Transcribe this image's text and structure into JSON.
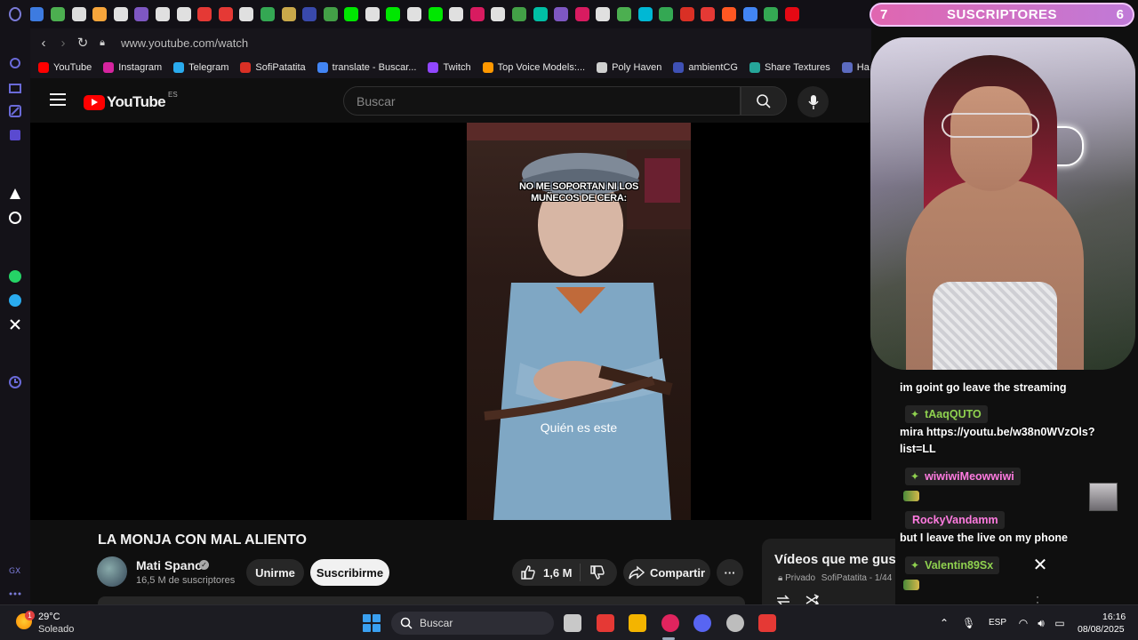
{
  "tabs_strip": {
    "icon_colors": [
      "#2a2a2a",
      "#3d7be0",
      "#4caf50",
      "#dcdcdc",
      "#f7a53b",
      "#e0e0e0",
      "#7e57c2",
      "#e0e0e0",
      "#e0e0e0",
      "#e53935",
      "#e53935",
      "#e0e0e0",
      "#34a853",
      "#c9a84a",
      "#3949ab",
      "#43a047",
      "#00e701",
      "#e0e0e0",
      "#00e701",
      "#e0e0e0",
      "#00e701",
      "#e0e0e0",
      "#d81b60",
      "#e0e0e0",
      "#43a047",
      "#00bfa5",
      "#7e57c2",
      "#d81b60",
      "#e0e0e0",
      "#4caf50",
      "#00b8d4",
      "#34a853",
      "#d93025",
      "#e53935",
      "#ff5722",
      "#4285f4",
      "#34a853",
      "#e50914"
    ]
  },
  "suscriptores": {
    "left_count": "7",
    "label": "SUSCRIPTORES",
    "right_count": "6"
  },
  "address_bar": {
    "url": "www.youtube.com/watch"
  },
  "bookmarks": [
    {
      "label": "YouTube",
      "color": "#ff0000"
    },
    {
      "label": "Instagram",
      "color": "#d6249f"
    },
    {
      "label": "Telegram",
      "color": "#2aabee"
    },
    {
      "label": "SofiPatatita",
      "color": "#d93025"
    },
    {
      "label": "translate - Buscar...",
      "color": "#4285f4"
    },
    {
      "label": "Twitch",
      "color": "#9146ff"
    },
    {
      "label": "Top Voice Models:...",
      "color": "#ff9800"
    },
    {
      "label": "Poly Haven",
      "color": "#cfcfcf"
    },
    {
      "label": "ambientCG",
      "color": "#3f51b5"
    },
    {
      "label": "Share Textures",
      "color": "#26a69a"
    },
    {
      "label": "Ha",
      "color": "#5c6bc0"
    }
  ],
  "youtube": {
    "logo_text": "YouTube",
    "country_code": "ES",
    "search_placeholder": "Buscar"
  },
  "video": {
    "caption_top_line1": "NO ME SOPORTAN NI LOS",
    "caption_top_line2": "MUÑECOS DE CERA:",
    "subtitle": "Quién es este",
    "title": "LA MONJA CON MAL ALIENTO",
    "channel_name": "Mati Spano",
    "subscribers": "16,5 M de suscriptores",
    "join_label": "Unirme",
    "subscribe_label": "Suscribirme",
    "likes": "1,6 M",
    "share_label": "Compartir",
    "more_label": "···"
  },
  "playlist": {
    "title": "Vídeos que me gusta",
    "privacy": "Privado",
    "owner": "SofiPatatita",
    "position": "1/44"
  },
  "chat": {
    "messages": [
      {
        "type": "text",
        "text": "im goint go leave the streaming"
      },
      {
        "type": "user",
        "name": "tAaqQUTO",
        "color": "#8fd14f"
      },
      {
        "type": "text",
        "text": "mira https://youtu.be/w38n0WVzOls?list=LL"
      },
      {
        "type": "user",
        "name": "wiwiwiMeowwiwi",
        "color": "#ff7be0"
      },
      {
        "type": "user",
        "name": "RockyVandamm",
        "color": "#ff7be0"
      },
      {
        "type": "text",
        "text": "but I leave the live on my phone"
      },
      {
        "type": "user",
        "name": "Valentin89Sx",
        "color": "#8fd14f"
      }
    ],
    "close_label": "✕"
  },
  "taskbar": {
    "weather_temp": "29°C",
    "weather_desc": "Soleado",
    "weather_badge": "1",
    "search_label": "Buscar",
    "language": "ESP",
    "time": "16:16",
    "date": "08/08/2025",
    "app_colors": [
      "#c8c8c8",
      "#e53935",
      "#f4b400",
      "#e0245e",
      "#5865f2",
      "#bdbdbd",
      "#e53935"
    ]
  }
}
